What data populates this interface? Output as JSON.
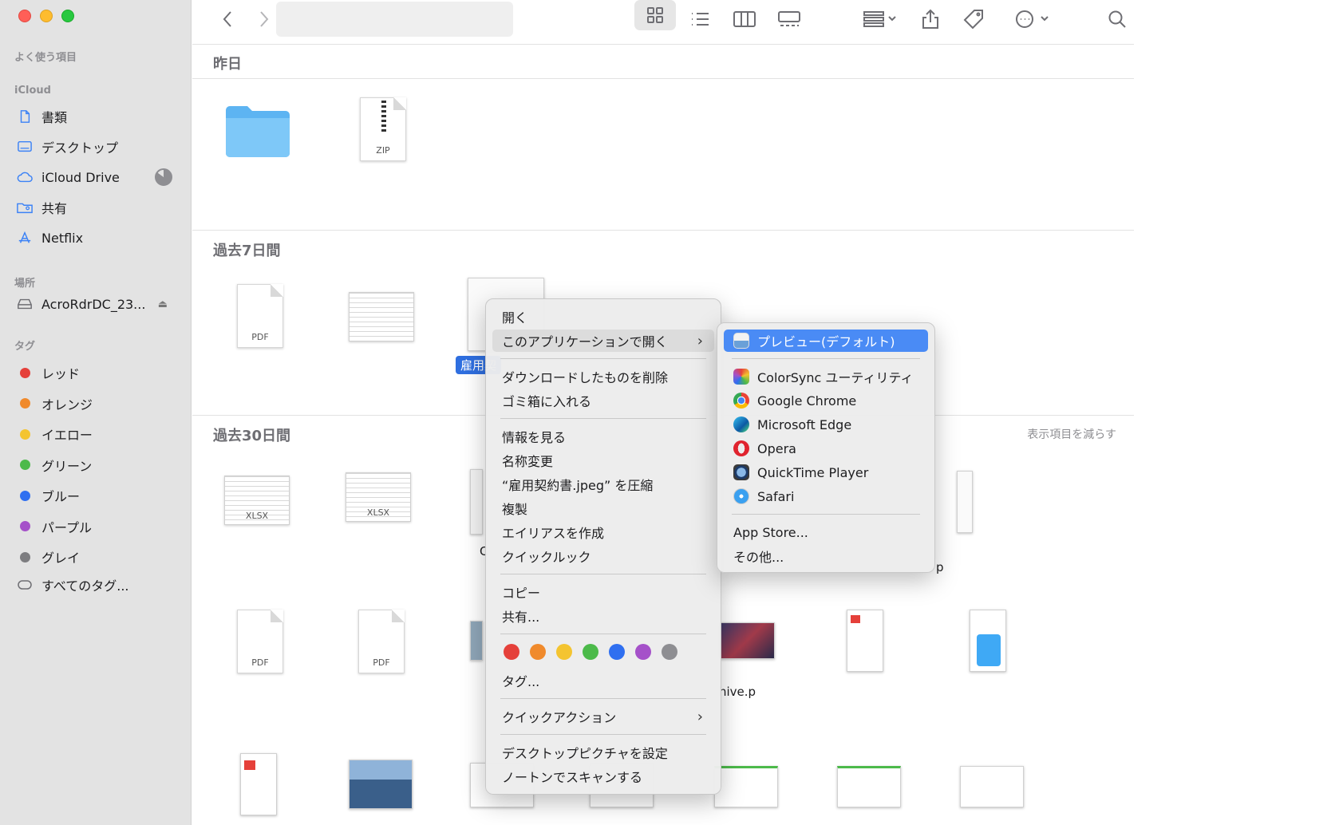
{
  "sidebar": {
    "favorites_label": "よく使う項目",
    "icloud_label": "iCloud",
    "icloud_items": [
      "書類",
      "デスクトップ",
      "iCloud Drive",
      "共有",
      "Netflix"
    ],
    "locations_label": "場所",
    "location_item": "AcroRdrDC_23...",
    "tags_label": "タグ",
    "tags": [
      {
        "name": "レッド",
        "color": "#e5403a"
      },
      {
        "name": "オレンジ",
        "color": "#f08a2c"
      },
      {
        "name": "イエロー",
        "color": "#f4c430"
      },
      {
        "name": "グリーン",
        "color": "#4cba4a"
      },
      {
        "name": "ブルー",
        "color": "#2f6ff0"
      },
      {
        "name": "パープル",
        "color": "#a551c9"
      },
      {
        "name": "グレイ",
        "color": "#7d7d80"
      }
    ],
    "all_tags": "すべてのタグ..."
  },
  "groups": {
    "yesterday": "昨日",
    "last7": "過去7日間",
    "last30": "過去30日間",
    "show_less": "表示項目を減らす"
  },
  "files": {
    "zip_label": "ZIP",
    "pdf_label": "PDF",
    "xlsx_label": "XLSX",
    "selected_name": "雇用契",
    "partial_hive": "hive.p",
    "partial_p": "p",
    "partial_c": "C"
  },
  "menu": {
    "open": "開く",
    "open_with": "このアプリケーションで開く",
    "delete_download": "ダウンロードしたものを削除",
    "trash": "ゴミ箱に入れる",
    "get_info": "情報を見る",
    "rename": "名称変更",
    "compress": "“雇用契約書.jpeg” を圧縮",
    "duplicate": "複製",
    "alias": "エイリアスを作成",
    "quicklook": "クイックルック",
    "copy": "コピー",
    "share": "共有...",
    "tags": "タグ...",
    "quick_actions": "クイックアクション",
    "desktop_picture": "デスクトップピクチャを設定",
    "norton_scan": "ノートンでスキャンする",
    "tag_colors": [
      "#e5403a",
      "#f08a2c",
      "#f4c430",
      "#4cba4a",
      "#2f6ff0",
      "#a551c9",
      "#8e8e92"
    ]
  },
  "submenu": {
    "preview": "プレビュー(デフォルト)",
    "colorsync": "ColorSync ユーティリティ",
    "chrome": "Google Chrome",
    "edge": "Microsoft Edge",
    "opera": "Opera",
    "quicktime": "QuickTime Player",
    "safari": "Safari",
    "app_store": "App Store...",
    "other": "その他..."
  }
}
